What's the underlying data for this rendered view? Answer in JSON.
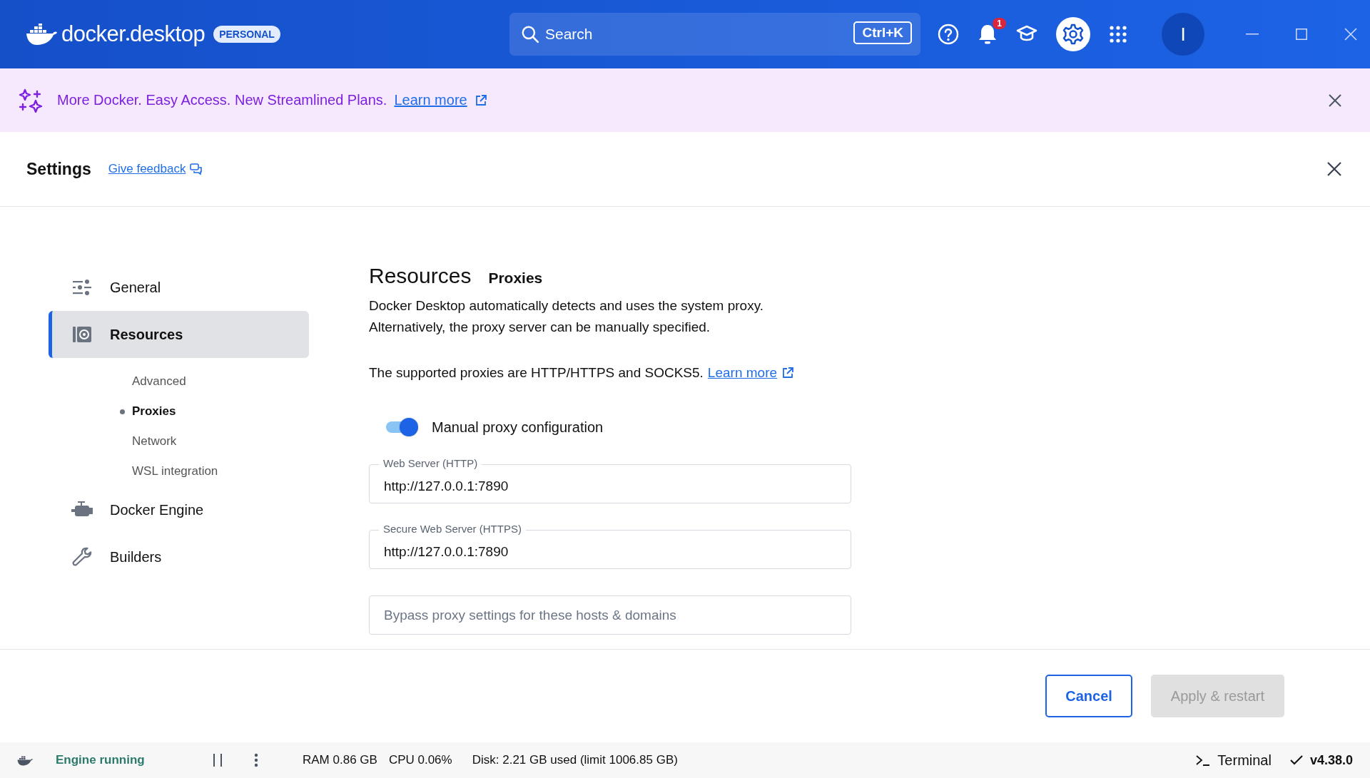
{
  "titlebar": {
    "brand_1": "docker",
    "brand_2": "desktop",
    "plan_badge": "PERSONAL",
    "search": {
      "placeholder": "Search",
      "shortcut": "Ctrl+K"
    },
    "notification_count": "1",
    "settings_selected": true,
    "avatar_initial": "I"
  },
  "banner": {
    "text": "More Docker. Easy Access. New Streamlined Plans.",
    "link": "Learn more"
  },
  "settings": {
    "title": "Settings",
    "feedback_link": "Give feedback"
  },
  "sidebar": {
    "items": [
      {
        "label": "General",
        "kind": "sliders",
        "selected": false
      },
      {
        "label": "Resources",
        "kind": "disk",
        "selected": true,
        "children": [
          {
            "label": "Advanced",
            "selected": false
          },
          {
            "label": "Proxies",
            "selected": true
          },
          {
            "label": "Network",
            "selected": false
          },
          {
            "label": "WSL integration",
            "selected": false
          }
        ]
      },
      {
        "label": "Docker Engine",
        "kind": "engine",
        "selected": false
      },
      {
        "label": "Builders",
        "kind": "wrench",
        "selected": false
      }
    ]
  },
  "page": {
    "title": "Resources",
    "subtitle": "Proxies",
    "description_lines": [
      "Docker Desktop automatically detects and uses the system proxy.",
      "Alternatively, the proxy server can be manually specified."
    ],
    "supported_text": "The supported proxies are HTTP/HTTPS and SOCKS5.",
    "learn_more": "Learn more",
    "toggle": {
      "label": "Manual proxy configuration",
      "on": true
    },
    "fields": [
      {
        "label": "Web Server (HTTP)",
        "value": "http://127.0.0.1:7890"
      },
      {
        "label": "Secure Web Server (HTTPS)",
        "value": "http://127.0.0.1:7890"
      },
      {
        "placeholder": "Bypass proxy settings for these hosts & domains"
      }
    ]
  },
  "actions": [
    {
      "label": "Cancel",
      "disabled": false
    },
    {
      "label": "Apply & restart",
      "disabled": true
    }
  ],
  "status_bar": {
    "engine": "Engine running",
    "ram": "RAM 0.86 GB",
    "cpu": "CPU 0.06%",
    "disk": "Disk: 2.21 GB used (limit 1006.85 GB)",
    "terminal": "Terminal",
    "version": "v4.38.0"
  }
}
